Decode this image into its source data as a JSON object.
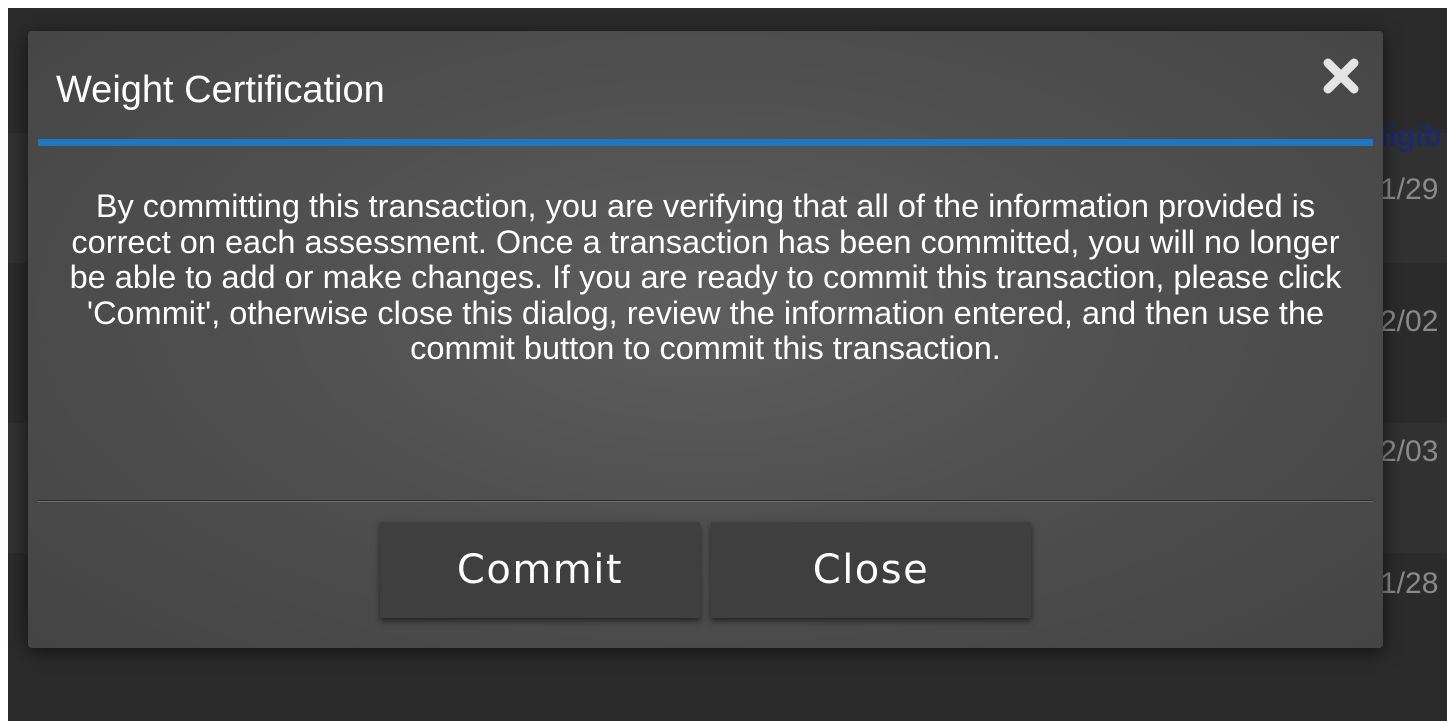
{
  "background": {
    "column_header": "ligib",
    "row_cells": [
      "1/29",
      "2/02",
      "2/03",
      "1/28"
    ]
  },
  "dialog": {
    "title": "Weight Certification",
    "close_icon": "close-icon",
    "message": "By committing this transaction, you are verifying that all of the information provided is correct on each assessment. Once a transaction has been committed, you will no longer be able to add or make changes. If you are ready to commit this transaction, please click 'Commit', otherwise close this dialog, review the information entered, and then use the commit button to commit this transaction.",
    "buttons": {
      "commit_label": "Commit",
      "close_label": "Close"
    }
  },
  "colors": {
    "accent": "#1f77c4",
    "dialog_background": "#505050",
    "button_background": "#3f3f3f",
    "backdrop": "#2b2b2b"
  }
}
